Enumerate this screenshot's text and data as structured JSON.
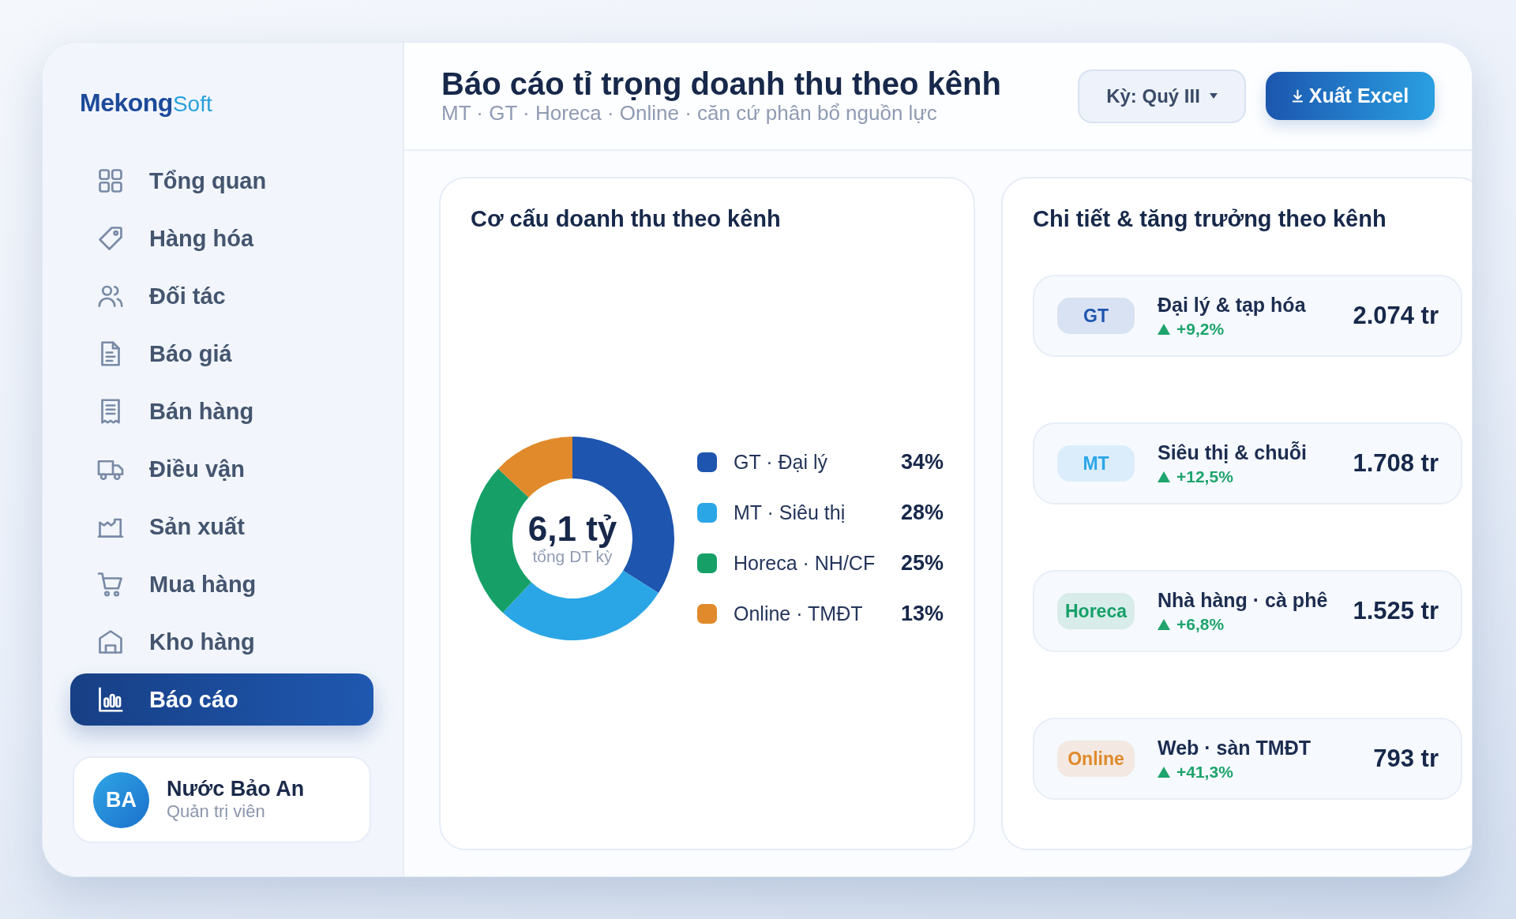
{
  "sidebar": {
    "logo": {
      "primary": "Mekong",
      "secondary": "Soft"
    },
    "items": [
      {
        "label": "Tổng quan",
        "selected": false
      },
      {
        "label": "Hàng hóa",
        "selected": false
      },
      {
        "label": "Đối tác",
        "selected": false
      },
      {
        "label": "Báo giá",
        "selected": false
      },
      {
        "label": "Bán hàng",
        "selected": false
      },
      {
        "label": "Điều vận",
        "selected": false
      },
      {
        "label": "Sản xuất",
        "selected": false
      },
      {
        "label": "Mua hàng",
        "selected": false
      },
      {
        "label": "Kho hàng",
        "selected": false
      },
      {
        "label": "Báo cáo",
        "selected": true
      }
    ],
    "user": {
      "initials": "BA",
      "name": "Nước Bảo An",
      "role": "Quản trị viên"
    }
  },
  "header": {
    "title": "Báo cáo tỉ trọng doanh thu theo kênh",
    "subtitle": "MT · GT · Horeca · Online · căn cứ phân bổ nguồn lực",
    "period": "Kỳ: Quý III",
    "export_label": "Xuất Excel"
  },
  "revenue_mix": {
    "title": "Cơ cấu doanh thu theo kênh",
    "chart_data": {
      "type": "donut",
      "categories": [
        "GT · Đại lý",
        "MT · Siêu thị",
        "Horeca · NH/CF",
        "Online · TMĐT"
      ],
      "values": [
        34,
        28,
        25,
        13
      ]
    },
    "center_value": "6,1 tỷ",
    "center_label": "tổng DT kỳ",
    "legend": [
      {
        "percent": "34%",
        "color": "#1e55ae"
      },
      {
        "percent": "28%",
        "color": "#2aa6e6"
      },
      {
        "percent": "25%",
        "color": "#16a068"
      },
      {
        "percent": "13%",
        "color": "#e08a2b"
      }
    ]
  },
  "channel_details": {
    "title": "Chi tiết & tăng trưởng theo kênh",
    "rows": [
      {
        "badge": "GT",
        "name": "Đại lý & tạp hóa",
        "growth": "+9,2%",
        "value": "2.074 tr",
        "color": "#1e55ae"
      },
      {
        "badge": "MT",
        "name": "Siêu thị & chuỗi",
        "growth": "+12,5%",
        "value": "1.708 tr",
        "color": "#2aa6e6"
      },
      {
        "badge": "Horeca",
        "name": "Nhà hàng · cà phê",
        "growth": "+6,8%",
        "value": "1.525 tr",
        "color": "#16a068"
      },
      {
        "badge": "Online",
        "name": "Web · sàn TMĐT",
        "growth": "+41,3%",
        "value": "793 tr",
        "color": "#e08a2b"
      }
    ]
  }
}
